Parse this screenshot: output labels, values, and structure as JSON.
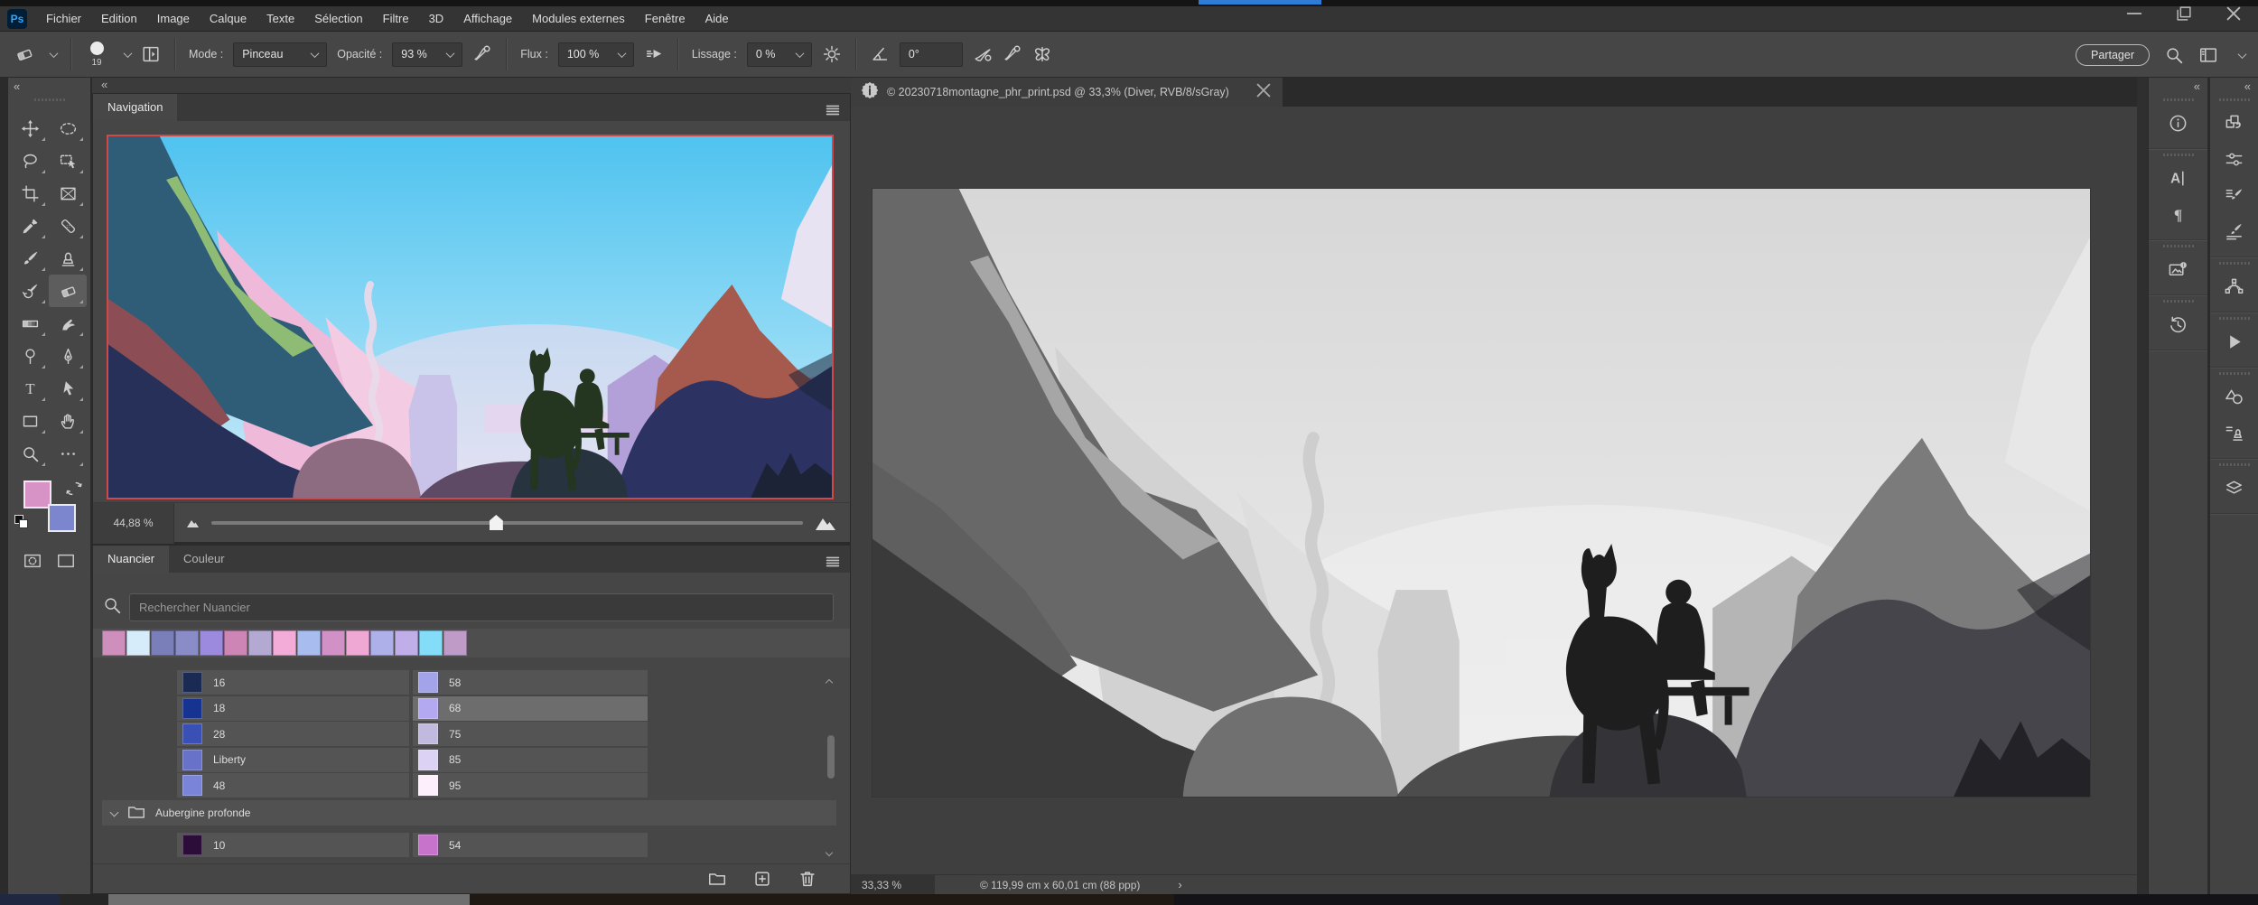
{
  "ui": {
    "accent_blue": "#2e7cd6",
    "navigator_view_border": "#d04848",
    "collapse_glyph": "«",
    "status_chevron": "›"
  },
  "menubar": {
    "logo": "Ps",
    "items": [
      "Fichier",
      "Edition",
      "Image",
      "Calque",
      "Texte",
      "Sélection",
      "Filtre",
      "3D",
      "Affichage",
      "Modules externes",
      "Fenêtre",
      "Aide"
    ]
  },
  "options_bar": {
    "brush_size": "19",
    "mode_label": "Mode :",
    "mode_value": "Pinceau",
    "opacity_label": "Opacité :",
    "opacity_value": "93 %",
    "flow_label": "Flux :",
    "flow_value": "100 %",
    "smoothing_label": "Lissage :",
    "smoothing_value": "0 %",
    "angle_value": "0°",
    "share_button": "Partager"
  },
  "toolbar": {
    "foreground_color": "#d793c5",
    "background_color": "#7b86cf",
    "tools": [
      {
        "icon": "move-tool"
      },
      {
        "icon": "marquee-tool"
      },
      {
        "icon": "lasso-tool"
      },
      {
        "icon": "object-selection-tool"
      },
      {
        "icon": "crop-tool"
      },
      {
        "icon": "frame-tool"
      },
      {
        "icon": "eyedropper-tool"
      },
      {
        "icon": "healing-brush-tool"
      },
      {
        "icon": "brush-tool"
      },
      {
        "icon": "clone-stamp-tool"
      },
      {
        "icon": "history-brush-tool"
      },
      {
        "icon": "eraser-tool",
        "selected": true
      },
      {
        "icon": "gradient-tool"
      },
      {
        "icon": "smudge-tool"
      },
      {
        "icon": "dodge-tool"
      },
      {
        "icon": "pen-tool"
      },
      {
        "icon": "type-tool"
      },
      {
        "icon": "path-selection-tool"
      },
      {
        "icon": "rectangle-tool"
      },
      {
        "icon": "hand-tool"
      },
      {
        "icon": "zoom-tool"
      },
      {
        "icon": "more-tools"
      }
    ]
  },
  "navigator": {
    "tab": "Navigation",
    "zoom": "44,88 %"
  },
  "swatches": {
    "tabs": [
      {
        "label": "Nuancier"
      },
      {
        "label": "Couleur"
      }
    ],
    "search_placeholder": "Rechercher Nuancier",
    "recent": [
      "#cf8fbc",
      "#d6ecfa",
      "#7a7fba",
      "#8a8cc8",
      "#9c8ade",
      "#cc85b5",
      "#b3a9d2",
      "#f3abd8",
      "#a9bcf0",
      "#d291c6",
      "#efa8d4",
      "#aeb0ea",
      "#bfaee8",
      "#83dcf8",
      "#bf9cc8"
    ],
    "rows": [
      [
        {
          "label": "16",
          "color": "#1b2a52"
        },
        {
          "label": "58",
          "color": "#a2a3e9"
        }
      ],
      [
        {
          "label": "18",
          "color": "#173391"
        },
        {
          "label": "68",
          "color": "#b2a9f1",
          "selected": true
        }
      ],
      [
        {
          "label": "28",
          "color": "#3a50b5"
        },
        {
          "label": "75",
          "color": "#c2bade"
        }
      ],
      [
        {
          "label": "Liberty",
          "color": "#6872c9"
        },
        {
          "label": "85",
          "color": "#dcd2f3"
        }
      ],
      [
        {
          "label": "48",
          "color": "#7a85d9"
        },
        {
          "label": "95",
          "color": "#fdeffb"
        }
      ]
    ],
    "group_label": "Aubergine profonde",
    "group_rows": [
      [
        {
          "label": "10",
          "color": "#2c0c39"
        },
        {
          "label": "54",
          "color": "#c772cb"
        }
      ]
    ]
  },
  "document": {
    "tab_title": "© 20230718montagne_phr_print.psd @ 33,3% (Diver, RVB/8/sGray)",
    "status_zoom": "33,33 %",
    "status_info": "© 119,99 cm x 60,01 cm (88 ppp)"
  },
  "right_docks": {
    "inner": [
      [
        "info-panel"
      ],
      [
        "character-panel",
        "paragraph-panel"
      ],
      [
        "libraries-panel"
      ],
      [
        "history-panel"
      ]
    ],
    "outer": [
      [
        "layer-comps-panel",
        "adjustments-panel",
        "brush-settings-panel",
        "brushes-panel"
      ],
      [
        "paths-panel"
      ],
      [
        "actions-panel"
      ],
      [
        "shapes-panel",
        "tool-presets-panel"
      ],
      [
        "layers-panel"
      ]
    ]
  },
  "artwork": {
    "color": {
      "skyTop": "#4fc3ef",
      "skyMid": "#8ed9f5",
      "skyLow": "#cfeaf8",
      "glow": "#f2dcee",
      "farWedge": "#e8e3f2",
      "mist": "#e3d6ee",
      "pink": "#efb9da",
      "pinkLight": "#f3cce4",
      "mesa": "#c9c3ea",
      "ridge": "#b3a0d8",
      "rust": "#a55a4d",
      "navy2": "#2c3363",
      "dark": "#1c2336",
      "teal": "#2f5d78",
      "green": "#8fbc74",
      "maroon": "#8c4e54",
      "navy": "#273059",
      "boulder": "#8d6b80",
      "ledge": "#5f4a66",
      "shadow": "#27333f",
      "path": "#e9d9e9",
      "sil": "#243520"
    },
    "gray": {
      "skyTop": "#d7d7d7",
      "skyMid": "#e3e3e3",
      "skyLow": "#ececec",
      "glow": "#f0f0f0",
      "farWedge": "#e7e7e7",
      "mist": "#ededed",
      "pink": "#d2d2d2",
      "pinkLight": "#dedede",
      "mesa": "#cdcdcd",
      "ridge": "#b5b5b5",
      "rust": "#7b7b7b",
      "navy2": "#45454b",
      "dark": "#232327",
      "teal": "#686868",
      "green": "#a6a6a6",
      "maroon": "#5f5f5f",
      "navy": "#3a3a3a",
      "boulder": "#707070",
      "ledge": "#4c4c4c",
      "shadow": "#333338",
      "path": "#cccccc",
      "sil": "#1e1e1e"
    }
  }
}
